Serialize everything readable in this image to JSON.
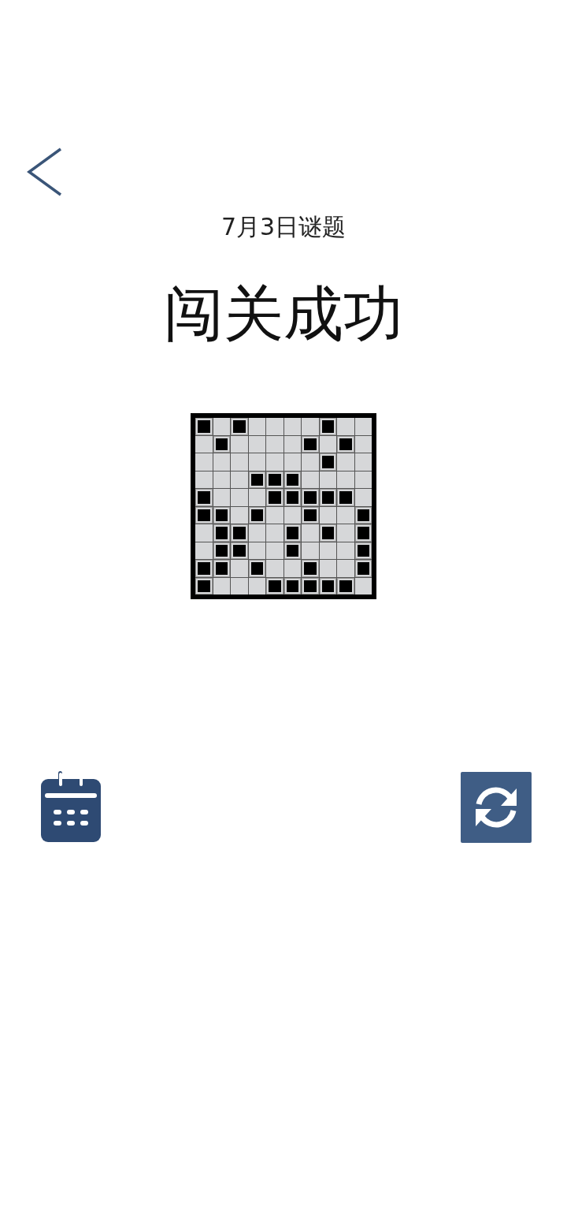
{
  "date_label": "7月3日谜题",
  "title": "闯关成功",
  "grid": {
    "rows": [
      [
        true,
        false,
        true,
        false,
        false,
        false,
        false,
        true,
        false,
        false
      ],
      [
        false,
        true,
        false,
        false,
        false,
        false,
        true,
        false,
        true,
        false
      ],
      [
        false,
        false,
        false,
        false,
        false,
        false,
        false,
        true,
        false,
        false
      ],
      [
        false,
        false,
        false,
        true,
        true,
        true,
        false,
        false,
        false,
        false
      ],
      [
        true,
        false,
        false,
        false,
        true,
        true,
        true,
        true,
        true,
        false
      ],
      [
        true,
        true,
        false,
        true,
        false,
        false,
        true,
        false,
        false,
        true
      ],
      [
        false,
        true,
        true,
        false,
        false,
        true,
        false,
        true,
        false,
        true
      ],
      [
        false,
        true,
        true,
        false,
        false,
        true,
        false,
        false,
        false,
        true
      ],
      [
        true,
        true,
        false,
        true,
        false,
        false,
        true,
        false,
        false,
        true
      ],
      [
        true,
        false,
        false,
        false,
        true,
        true,
        true,
        true,
        true,
        false
      ]
    ]
  }
}
